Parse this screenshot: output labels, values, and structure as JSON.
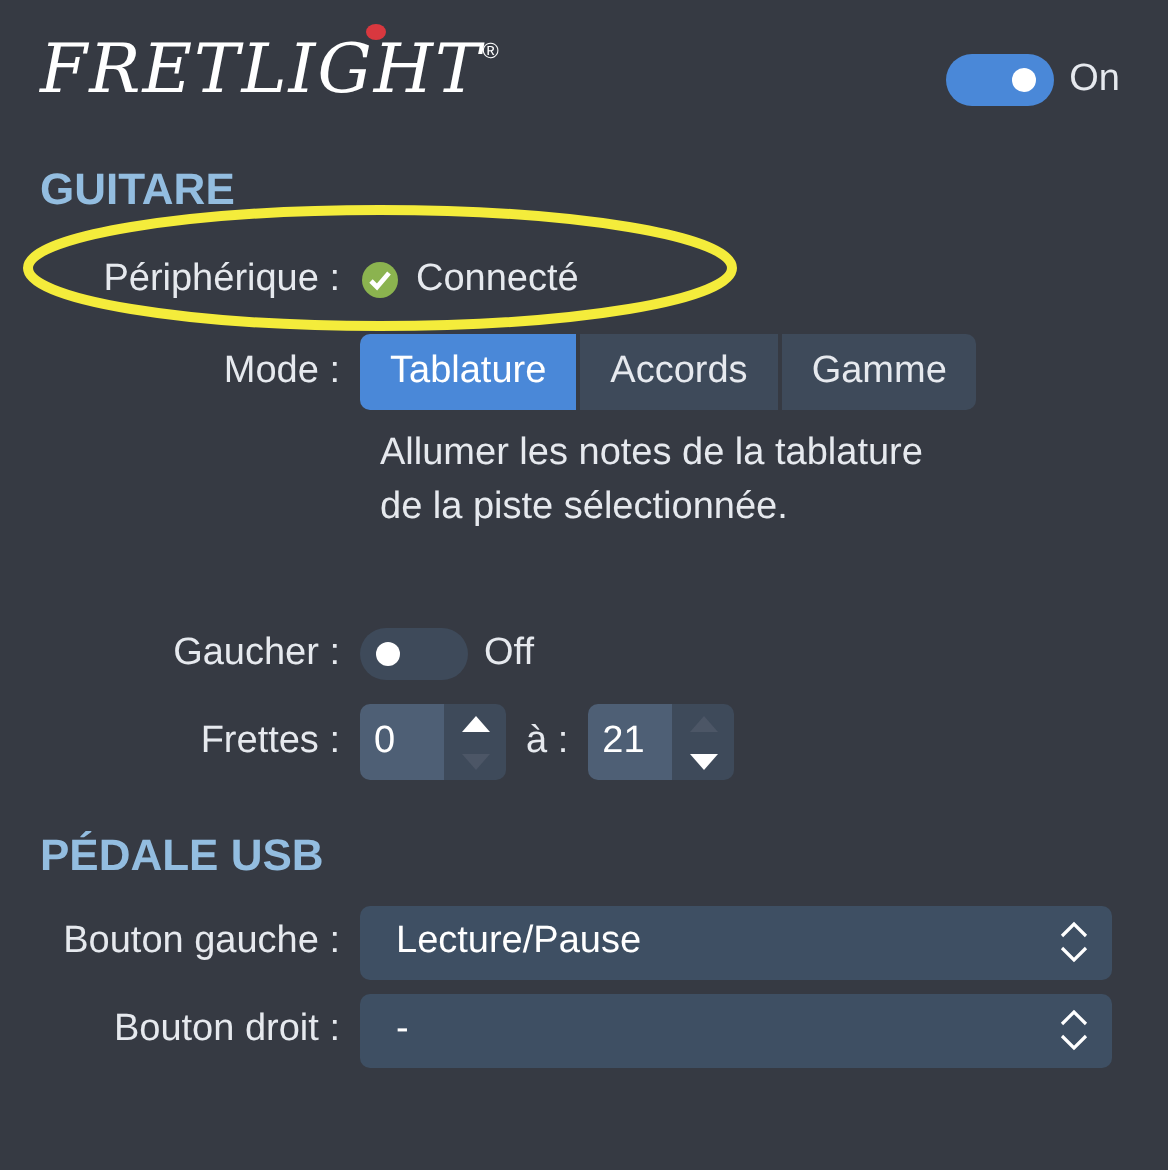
{
  "header": {
    "logo": "FRETLIGHT",
    "logo_mark": "®",
    "power": {
      "on": true,
      "label": "On"
    }
  },
  "sections": [
    {
      "title": "GUITARE",
      "rows": [
        {
          "kind": "status",
          "label": "Périphérique :",
          "value": "Connecté",
          "connected": true,
          "circled": true
        },
        {
          "kind": "segmented",
          "label": "Mode :",
          "options": [
            {
              "label": "Tablature",
              "selected": true
            },
            {
              "label": "Accords",
              "selected": false
            },
            {
              "label": "Gamme",
              "selected": false
            }
          ],
          "description": "Allumer les notes de la tablature de la piste sélectionnée."
        },
        {
          "kind": "switch",
          "label": "Gaucher :",
          "on": false,
          "state_label": "Off"
        },
        {
          "kind": "range",
          "label": "Frettes :",
          "from": {
            "value": "0",
            "up_disabled": false,
            "down_disabled": true
          },
          "separator": "à :",
          "to": {
            "value": "21",
            "up_disabled": true,
            "down_disabled": false
          }
        }
      ]
    },
    {
      "title": "PÉDALE USB",
      "rows": [
        {
          "kind": "select",
          "label": "Bouton gauche :",
          "value": "Lecture/Pause"
        },
        {
          "kind": "select",
          "label": "Bouton droit :",
          "value": "-"
        }
      ]
    }
  ]
}
